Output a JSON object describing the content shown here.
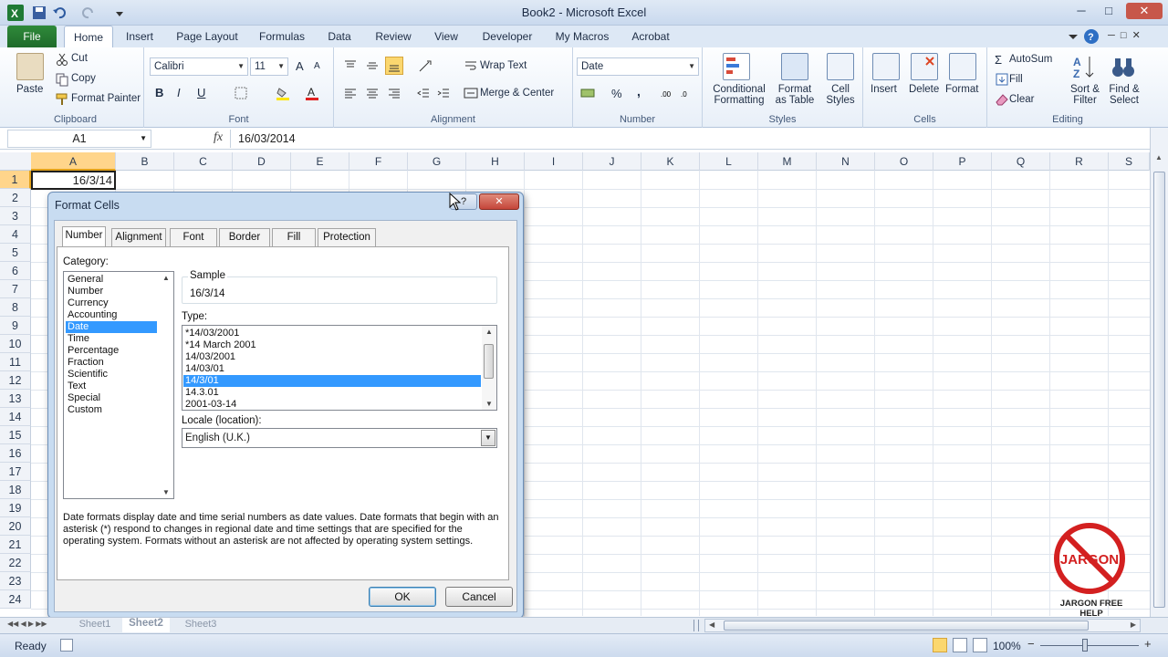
{
  "app": {
    "title": "Book2 - Microsoft Excel",
    "window_controls": [
      "─",
      "□",
      "✕"
    ]
  },
  "ribbon": {
    "tabs": [
      "File",
      "Home",
      "Insert",
      "Page Layout",
      "Formulas",
      "Data",
      "Review",
      "View",
      "Developer",
      "My Macros",
      "Acrobat"
    ],
    "active_tab": "Home",
    "clipboard": {
      "label": "Clipboard",
      "paste": "Paste",
      "cut": "Cut",
      "copy": "Copy",
      "format_painter": "Format Painter"
    },
    "font": {
      "label": "Font",
      "name": "Calibri",
      "size": "11",
      "grow": "A",
      "shrink": "A",
      "bold": "B",
      "italic": "I",
      "underline": "U"
    },
    "alignment": {
      "label": "Alignment",
      "wrap": "Wrap Text",
      "merge": "Merge & Center"
    },
    "number": {
      "label": "Number",
      "format": "Date",
      "percent": "%",
      "comma": ","
    },
    "styles": {
      "label": "Styles",
      "conditional_1": "Conditional",
      "conditional_2": "Formatting",
      "table_1": "Format",
      "table_2": "as Table",
      "cell_1": "Cell",
      "cell_2": "Styles"
    },
    "cells": {
      "label": "Cells",
      "insert": "Insert",
      "delete": "Delete",
      "format": "Format"
    },
    "editing": {
      "label": "Editing",
      "autosum": "AutoSum",
      "fill": "Fill",
      "clear": "Clear",
      "sort_1": "Sort &",
      "sort_2": "Filter",
      "find_1": "Find &",
      "find_2": "Select"
    }
  },
  "formula_bar": {
    "name_box": "A1",
    "fx": "fx",
    "value": "16/03/2014"
  },
  "grid": {
    "columns": [
      "A",
      "B",
      "C",
      "D",
      "E",
      "F",
      "G",
      "H",
      "I",
      "J",
      "K",
      "L",
      "M",
      "N",
      "O",
      "P",
      "Q",
      "R",
      "S"
    ],
    "rows": [
      "1",
      "2",
      "3",
      "4",
      "5",
      "6",
      "7",
      "8",
      "9",
      "10",
      "11",
      "12",
      "13",
      "14",
      "15",
      "16",
      "17",
      "18",
      "19",
      "20",
      "21",
      "22",
      "23",
      "24"
    ],
    "a1_value": "16/3/14"
  },
  "dialog": {
    "title": "Format Cells",
    "help": "?",
    "close": "✕",
    "tabs": [
      "Number",
      "Alignment",
      "Font",
      "Border",
      "Fill",
      "Protection"
    ],
    "active_tab": "Number",
    "category_label": "Category:",
    "categories": [
      "General",
      "Number",
      "Currency",
      "Accounting",
      "Date",
      "Time",
      "Percentage",
      "Fraction",
      "Scientific",
      "Text",
      "Special",
      "Custom"
    ],
    "selected_category": "Date",
    "sample_label": "Sample",
    "sample_value": "16/3/14",
    "type_label": "Type:",
    "types": [
      "*14/03/2001",
      "*14 March 2001",
      "14/03/2001",
      "14/03/01",
      "14/3/01",
      "14.3.01",
      "2001-03-14"
    ],
    "selected_type": "14/3/01",
    "locale_label": "Locale (location):",
    "locale_value": "English (U.K.)",
    "description": "Date formats display date and time serial numbers as date values.  Date formats that begin with an asterisk (*) respond to changes in regional date and time settings that are specified for the operating system. Formats without an asterisk are not affected by operating system settings.",
    "ok": "OK",
    "cancel": "Cancel"
  },
  "sheets": {
    "tabs": [
      "Sheet1",
      "Sheet2",
      "Sheet3"
    ],
    "active": "Sheet2"
  },
  "status": {
    "ready": "Ready",
    "zoom": "100%"
  },
  "watermark": {
    "logo_text": "JARGON",
    "caption": "JARGON FREE HELP"
  },
  "colors": {
    "excel_green": "#1f6b2a",
    "selection_blue": "#3399ff",
    "ribbon_bg": "#e8eff8",
    "logo_red": "#d32020"
  }
}
